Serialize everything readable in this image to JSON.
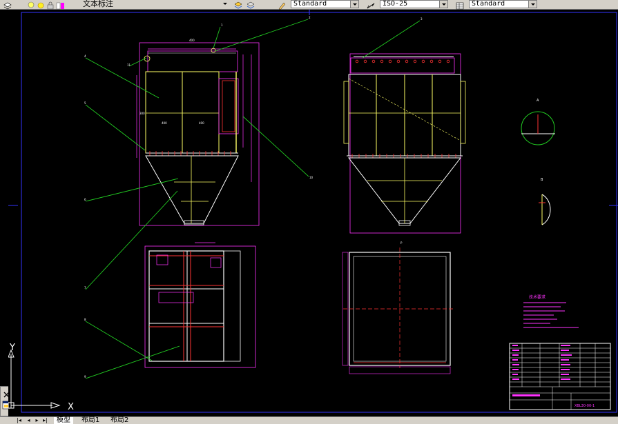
{
  "toolbar": {
    "text_style_layer": "文本标注",
    "text_style": "Standard",
    "dim_style": "ISO-25",
    "table_style": "Standard"
  },
  "ucs": {
    "x_label": "X",
    "y_label": "Y"
  },
  "tabs": {
    "model": "模型",
    "layout1": "布局1",
    "layout2": "布局2"
  },
  "notes": {
    "title": "技术要求"
  },
  "title_block": {
    "drawing_no": "XBL30-00-1"
  },
  "colors": {
    "background": "#000000",
    "yellow": "#ffff66",
    "magenta": "#ff33ff",
    "green": "#22cc22",
    "red": "#ff3333",
    "white": "#ffffff",
    "blue": "#3333ff"
  },
  "icons": [
    "layers-icon",
    "bulb-icon",
    "sun-icon",
    "lock-icon",
    "color-icon",
    "layer-states-icon",
    "dim-style-icon",
    "table-style-icon",
    "close-icon",
    "properties-icon"
  ]
}
